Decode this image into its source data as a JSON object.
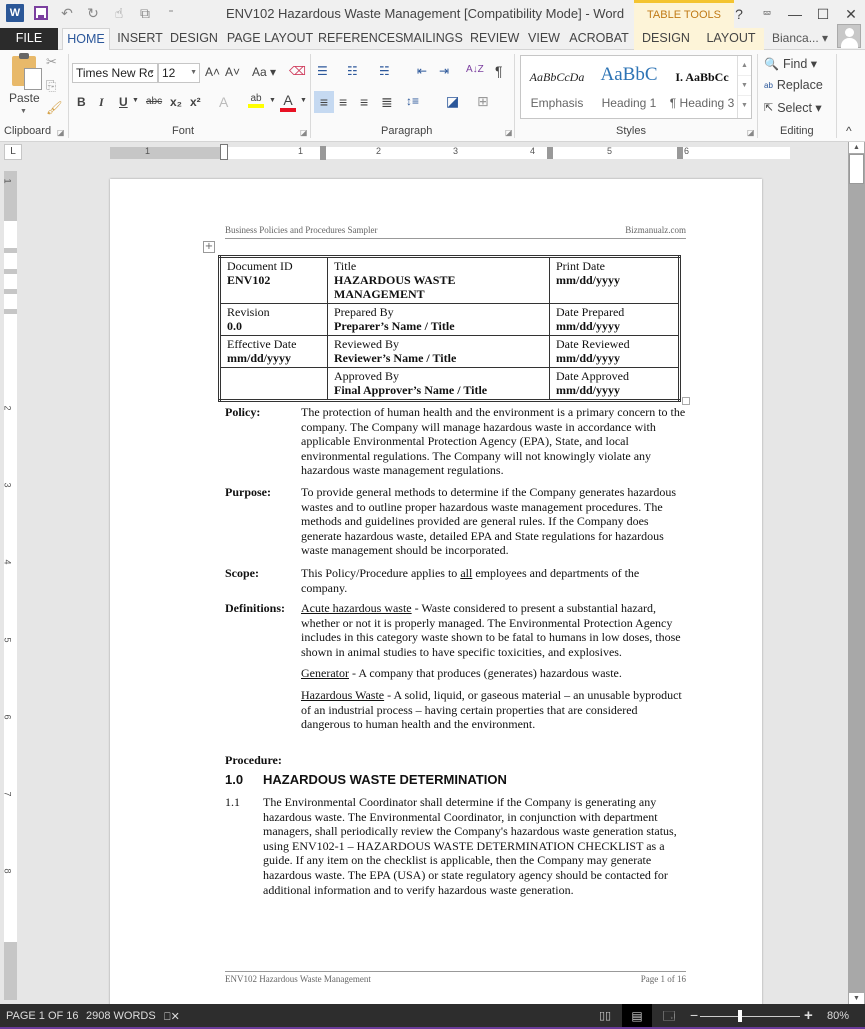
{
  "window": {
    "title": "ENV102 Hazardous Waste Management [Compatibility Mode] - Word",
    "contextual_group": "TABLE TOOLS",
    "help": "?",
    "restore_ribbon": "⮹",
    "minimize": "—",
    "maximize": "☐",
    "close": "✕"
  },
  "qat": {
    "app_icon": "W",
    "undo": "↶",
    "redo": "↻",
    "touch": "☝",
    "more": "⧉",
    "customize": "⁼"
  },
  "tabs": [
    "FILE",
    "HOME",
    "INSERT",
    "DESIGN",
    "PAGE LAYOUT",
    "REFERENCES",
    "MAILINGS",
    "REVIEW",
    "VIEW",
    "ACROBAT",
    "DESIGN",
    "LAYOUT"
  ],
  "user": {
    "name": "Bianca... ▾"
  },
  "ribbon": {
    "clipboard": {
      "paste": "Paste",
      "label": "Clipboard",
      "cut": "✂",
      "copy": "⎘",
      "format_painter": "🖌"
    },
    "font": {
      "family": "Times New Rc",
      "size": "12",
      "grow": "A˄",
      "shrink": "A˅",
      "change_case": "Aa ▾",
      "clear": "⌫",
      "bold": "B",
      "italic": "I",
      "underline": "U",
      "strike": "abc",
      "subscript": "x₂",
      "superscript": "x²",
      "text_effects": "A",
      "highlight": "ab",
      "font_color": "A",
      "label": "Font"
    },
    "paragraph": {
      "bullets": "☰",
      "numbering": "☷",
      "multilevel": "☵",
      "decrease_indent": "⇤",
      "increase_indent": "⇥",
      "sort": "A↓Z",
      "show_marks": "¶",
      "align_left": "≡",
      "center": "≡",
      "align_right": "≡",
      "justify": "≣",
      "line_spacing": "↕≡",
      "shading": "◪",
      "borders": "⊞",
      "label": "Paragraph"
    },
    "styles": {
      "items": [
        {
          "sample": "AaBbCcDa",
          "name": "Emphasis"
        },
        {
          "sample": "AaBbC",
          "name": "Heading 1"
        },
        {
          "sample": "I. AaBbCc",
          "name": "¶ Heading 3"
        }
      ],
      "label": "Styles"
    },
    "editing": {
      "find": "Find ▾",
      "replace": "Replace",
      "select": "Select ▾",
      "label": "Editing"
    },
    "collapse": "^"
  },
  "ruler": {
    "tab_selector": "L",
    "h_numbers": [
      "1",
      "1",
      "2",
      "3",
      "4",
      "5",
      "6"
    ],
    "v_numbers": [
      "1",
      "2",
      "3",
      "4",
      "5",
      "6",
      "7",
      "8"
    ]
  },
  "document": {
    "header_left": "Business Policies and Procedures Sampler",
    "header_right": "Bizmanualz.com",
    "table": [
      [
        {
          "label": "Document ID",
          "value": "ENV102"
        },
        {
          "label": "Title",
          "value": "HAZARDOUS WASTE MANAGEMENT"
        },
        {
          "label": "Print Date",
          "value": "mm/dd/yyyy"
        }
      ],
      [
        {
          "label": "Revision",
          "value": "0.0"
        },
        {
          "label": "Prepared By",
          "value": "Preparer’s Name / Title"
        },
        {
          "label": "Date Prepared",
          "value": "mm/dd/yyyy"
        }
      ],
      [
        {
          "label": "Effective Date",
          "value": "mm/dd/yyyy"
        },
        {
          "label": "Reviewed By",
          "value": "Reviewer’s Name / Title"
        },
        {
          "label": "Date Reviewed",
          "value": "mm/dd/yyyy"
        }
      ],
      [
        {
          "label": "",
          "value": ""
        },
        {
          "label": "Approved By",
          "value": "Final Approver’s Name / Title"
        },
        {
          "label": "Date Approved",
          "value": "mm/dd/yyyy"
        }
      ]
    ],
    "policy": {
      "key": "Policy:",
      "text": "The protection of human health and the environment is a primary concern to the company.  The Company will manage hazardous waste in accordance with applicable Environmental Protection Agency (EPA), State, and local environmental regulations.  The Company will not knowingly violate any hazardous waste management regulations."
    },
    "purpose": {
      "key": "Purpose:",
      "text": "To provide general methods to determine if the Company generates hazardous wastes and to outline proper hazardous waste management procedures.  The methods and guidelines provided are general rules.  If the Company does generate hazardous waste, detailed EPA and State regulations for hazardous waste management should be incorporated."
    },
    "scope": {
      "key": "Scope:",
      "pre": "This Policy/Procedure applies to ",
      "underlined": "all",
      "post": " employees and departments of the company."
    },
    "definitions": {
      "key": "Definitions:",
      "items": [
        {
          "term": "Acute hazardous waste",
          "text": " - Waste considered to present a substantial hazard, whether or not it is properly managed.  The Environmental Protection Agency includes in this category waste shown to be fatal to humans in low doses, those shown in animal studies to have specific toxicities, and explosives."
        },
        {
          "term": "Generator",
          "text": " - A company that produces (generates) hazardous waste."
        },
        {
          "term": "Hazardous Waste",
          "text": " - A solid, liquid, or gaseous material – an unusable byproduct of an industrial process – having certain properties that are considered dangerous to human health and the environment."
        }
      ]
    },
    "procedure_label": "Procedure:",
    "section": {
      "num": "1.0",
      "title": "HAZARDOUS WASTE DETERMINATION"
    },
    "item": {
      "num": "1.1",
      "text": "The Environmental Coordinator shall determine if the Company is generating any hazardous waste.  The Environmental Coordinator, in conjunction with department managers, shall periodically review the Company's hazardous waste generation status, using ENV102-1 – HAZARDOUS WASTE DETERMINATION CHECKLIST as a guide.  If any item on the checklist is applicable, then the Company may generate hazardous waste.  The EPA (USA) or state regulatory agency should be contacted for additional information and to verify hazardous waste generation."
    },
    "footer_left": "ENV102 Hazardous Waste Management",
    "footer_right": "Page 1 of 16"
  },
  "status": {
    "page": "PAGE 1 OF 16",
    "words": "2908 WORDS",
    "proofing": "⎕✕",
    "read_mode": "📖",
    "print_layout": "▤",
    "web_layout": "🗔",
    "zoom_out": "−",
    "zoom_in": "+",
    "zoom": "80%",
    "zoom_percent": 80
  },
  "colors": {
    "word_blue": "#2b579a",
    "file_tab": "#2b2b2b",
    "context_tab": "#fdf4d8",
    "context_accent": "#f4c430",
    "status_bar": "#2d2d2d",
    "highlight_yellow": "#ffff00",
    "font_red": "#e81123"
  }
}
